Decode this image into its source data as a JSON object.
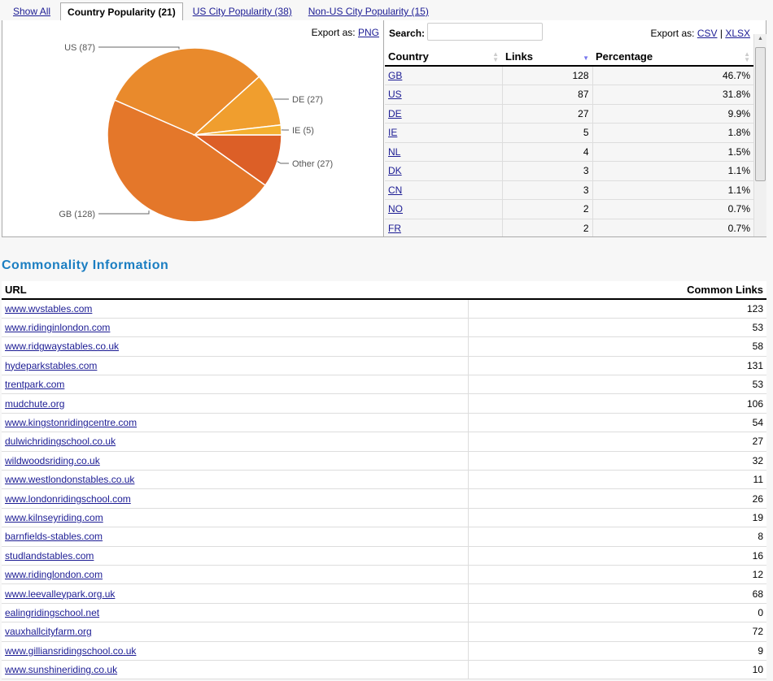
{
  "tabs": [
    "Show All",
    "Country Popularity (21)",
    "US City Popularity (38)",
    "Non-US City Popularity (15)"
  ],
  "chart": {
    "export_label": "Export as:",
    "export_png": "PNG"
  },
  "chart_data": {
    "type": "pie",
    "slices": [
      {
        "label": "Other (27)",
        "name": "Other",
        "value": 27,
        "color": "#dc5f27"
      },
      {
        "label": "GB (128)",
        "name": "GB",
        "value": 128,
        "color": "#e4772a"
      },
      {
        "label": "US (87)",
        "name": "US",
        "value": 87,
        "color": "#e98a2c"
      },
      {
        "label": "DE (27)",
        "name": "DE",
        "value": 27,
        "color": "#f09e2e"
      },
      {
        "label": "IE (5)",
        "name": "IE",
        "value": 5,
        "color": "#f4b030"
      }
    ]
  },
  "grid": {
    "search_label": "Search:",
    "search_value": "",
    "export_label": "Export as:",
    "export_csv": "CSV",
    "export_sep": "|",
    "export_xlsx": "XLSX",
    "columns": [
      "Country",
      "Links",
      "Percentage"
    ],
    "rows": [
      [
        "GB",
        "128",
        "46.7%"
      ],
      [
        "US",
        "87",
        "31.8%"
      ],
      [
        "DE",
        "27",
        "9.9%"
      ],
      [
        "IE",
        "5",
        "1.8%"
      ],
      [
        "NL",
        "4",
        "1.5%"
      ],
      [
        "DK",
        "3",
        "1.1%"
      ],
      [
        "CN",
        "3",
        "1.1%"
      ],
      [
        "NO",
        "2",
        "0.7%"
      ],
      [
        "FR",
        "2",
        "0.7%"
      ]
    ]
  },
  "commonality": {
    "title": "Commonality Information",
    "columns": [
      "URL",
      "Common Links"
    ],
    "rows": [
      [
        "www.wvstables.com",
        "123"
      ],
      [
        "www.ridinginlondon.com",
        "53"
      ],
      [
        "www.ridgwaystables.co.uk",
        "58"
      ],
      [
        "hydeparkstables.com",
        "131"
      ],
      [
        "trentpark.com",
        "53"
      ],
      [
        "mudchute.org",
        "106"
      ],
      [
        "www.kingstonridingcentre.com",
        "54"
      ],
      [
        "dulwichridingschool.co.uk",
        "27"
      ],
      [
        "wildwoodsriding.co.uk",
        "32"
      ],
      [
        "www.westlondonstables.co.uk",
        "11"
      ],
      [
        "www.londonridingschool.com",
        "26"
      ],
      [
        "www.kilnseyriding.com",
        "19"
      ],
      [
        "barnfields-stables.com",
        "8"
      ],
      [
        "studlandstables.com",
        "16"
      ],
      [
        "www.ridinglondon.com",
        "12"
      ],
      [
        "www.leevalleypark.org.uk",
        "68"
      ],
      [
        "ealingridingschool.net",
        "0"
      ],
      [
        "vauxhallcityfarm.org",
        "72"
      ],
      [
        "www.gilliansridingschool.co.uk",
        "9"
      ],
      [
        "www.sunshineriding.co.uk",
        "10"
      ]
    ]
  }
}
